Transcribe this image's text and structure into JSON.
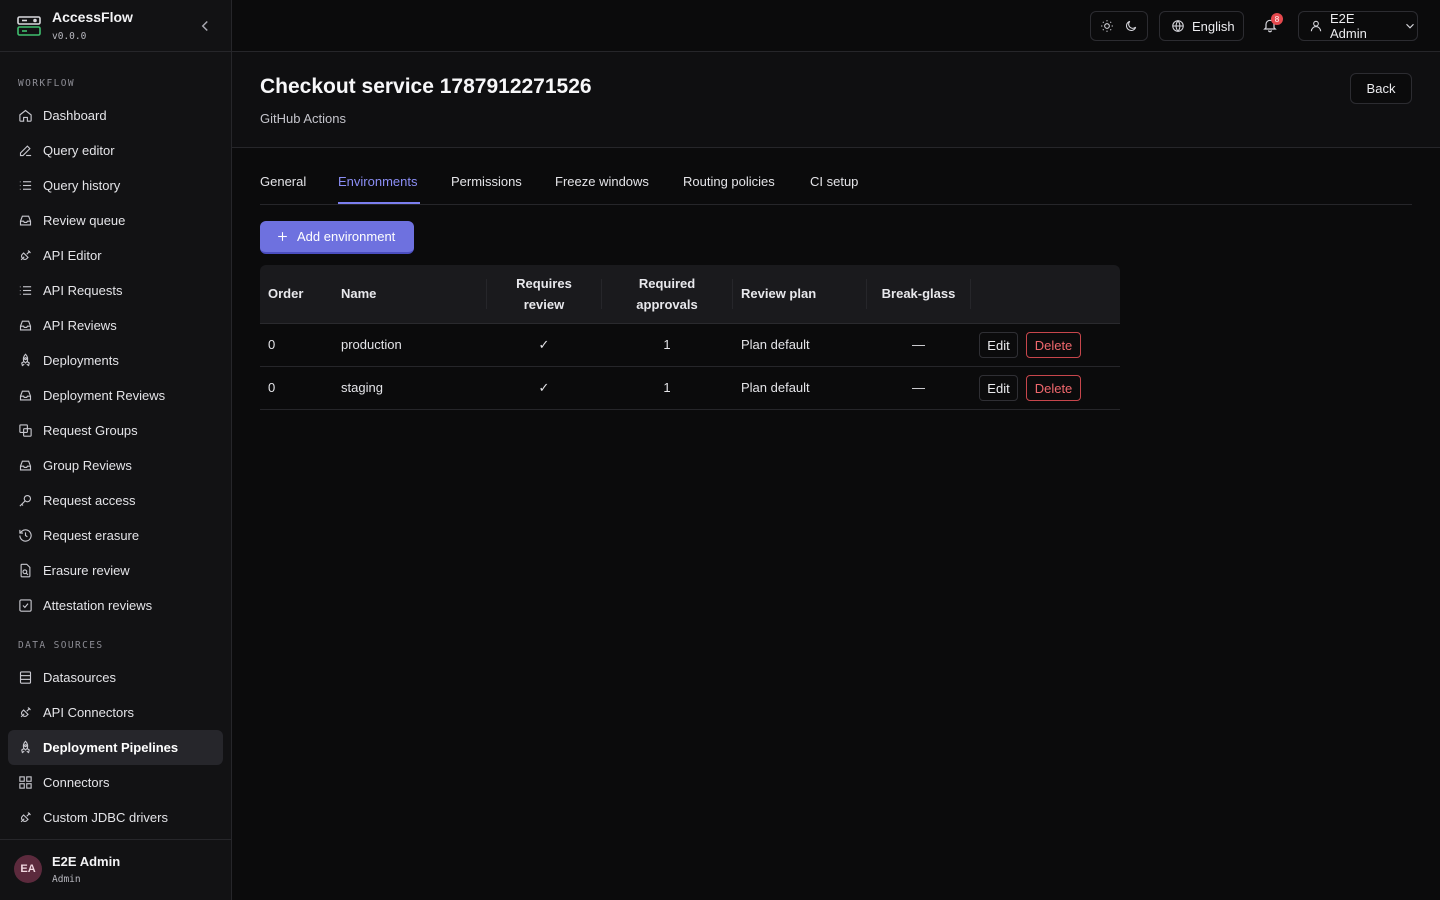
{
  "app": {
    "name": "AccessFlow",
    "version": "v0.0.0"
  },
  "sidebar": {
    "sections": [
      {
        "label": "WORKFLOW"
      },
      {
        "label": "DATA SOURCES"
      }
    ],
    "workflow_items": [
      {
        "label": "Dashboard",
        "icon": "home-icon"
      },
      {
        "label": "Query editor",
        "icon": "pencil-icon"
      },
      {
        "label": "Query history",
        "icon": "list-icon"
      },
      {
        "label": "Review queue",
        "icon": "inbox-icon"
      },
      {
        "label": "API Editor",
        "icon": "plug-icon"
      },
      {
        "label": "API Requests",
        "icon": "list-icon"
      },
      {
        "label": "API Reviews",
        "icon": "inbox-icon"
      },
      {
        "label": "Deployments",
        "icon": "rocket-icon"
      },
      {
        "label": "Deployment Reviews",
        "icon": "inbox-icon"
      },
      {
        "label": "Request Groups",
        "icon": "copy-icon"
      },
      {
        "label": "Group Reviews",
        "icon": "inbox-icon"
      },
      {
        "label": "Request access",
        "icon": "key-icon"
      },
      {
        "label": "Request erasure",
        "icon": "history-icon"
      },
      {
        "label": "Erasure review",
        "icon": "file-search-icon"
      },
      {
        "label": "Attestation reviews",
        "icon": "check-square-icon"
      }
    ],
    "datasource_items": [
      {
        "label": "Datasources",
        "icon": "database-icon"
      },
      {
        "label": "API Connectors",
        "icon": "plug-icon"
      },
      {
        "label": "Deployment Pipelines",
        "icon": "rocket-icon",
        "active": true
      },
      {
        "label": "Connectors",
        "icon": "grid-icon"
      },
      {
        "label": "Custom JDBC drivers",
        "icon": "plug-icon"
      }
    ],
    "user": {
      "initials": "EA",
      "name": "E2E Admin",
      "role": "Admin"
    }
  },
  "topbar": {
    "language": "English",
    "notification_count": "8",
    "user_label": "E2E Admin"
  },
  "page": {
    "title": "Checkout service 1787912271526",
    "subtitle": "GitHub Actions",
    "back_label": "Back"
  },
  "tabs": [
    {
      "label": "General"
    },
    {
      "label": "Environments",
      "active": true
    },
    {
      "label": "Permissions"
    },
    {
      "label": "Freeze windows"
    },
    {
      "label": "Routing policies"
    },
    {
      "label": "CI setup"
    }
  ],
  "add_button_label": "Add environment",
  "table": {
    "headers": {
      "order": "Order",
      "name": "Name",
      "requires_review_1": "Requires",
      "requires_review_2": "review",
      "required_approvals_1": "Required",
      "required_approvals_2": "approvals",
      "review_plan": "Review plan",
      "break_glass": "Break-glass"
    },
    "rows": [
      {
        "order": "0",
        "name": "production",
        "requires_review": "✓",
        "required_approvals": "1",
        "review_plan": "Plan default",
        "break_glass": "—",
        "edit": "Edit",
        "delete": "Delete"
      },
      {
        "order": "0",
        "name": "staging",
        "requires_review": "✓",
        "required_approvals": "1",
        "review_plan": "Plan default",
        "break_glass": "—",
        "edit": "Edit",
        "delete": "Delete"
      }
    ]
  },
  "colors": {
    "accent": "#6e71df",
    "danger": "#e5484d",
    "background": "#0b0b0c"
  }
}
